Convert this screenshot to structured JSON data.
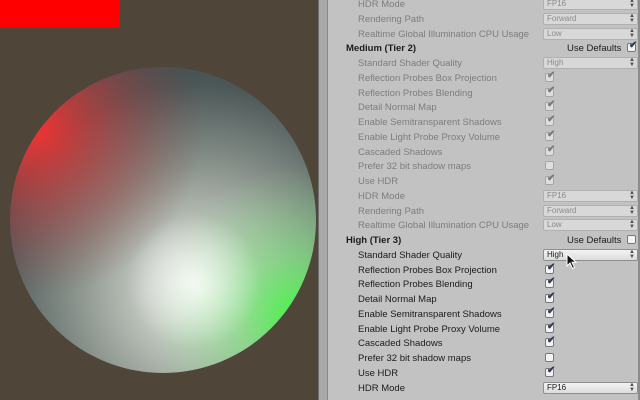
{
  "colors": {
    "viewport_bg": "#4f4639",
    "red_rect": "#ff0000",
    "panel_bg": "#c2c2c2"
  },
  "rows": [
    {
      "label": "HDR Mode",
      "control": "dropdown",
      "value": "FP16",
      "enabled": false
    },
    {
      "label": "Rendering Path",
      "control": "dropdown",
      "value": "Forward",
      "enabled": false
    },
    {
      "label": "Realtime Global Illumination CPU Usage",
      "control": "dropdown",
      "value": "Low",
      "enabled": false
    },
    {
      "label": "Medium (Tier 2)",
      "control": "header",
      "use_defaults_label": "Use Defaults",
      "checked": true
    },
    {
      "label": "Standard Shader Quality",
      "control": "dropdown",
      "value": "High",
      "enabled": false
    },
    {
      "label": "Reflection Probes Box Projection",
      "control": "checkbox",
      "checked": true,
      "enabled": false
    },
    {
      "label": "Reflection Probes Blending",
      "control": "checkbox",
      "checked": true,
      "enabled": false
    },
    {
      "label": "Detail Normal Map",
      "control": "checkbox",
      "checked": true,
      "enabled": false
    },
    {
      "label": "Enable Semitransparent Shadows",
      "control": "checkbox",
      "checked": true,
      "enabled": false
    },
    {
      "label": "Enable Light Probe Proxy Volume",
      "control": "checkbox",
      "checked": true,
      "enabled": false
    },
    {
      "label": "Cascaded Shadows",
      "control": "checkbox",
      "checked": true,
      "enabled": false
    },
    {
      "label": "Prefer 32 bit shadow maps",
      "control": "checkbox",
      "checked": false,
      "enabled": false
    },
    {
      "label": "Use HDR",
      "control": "checkbox",
      "checked": true,
      "enabled": false
    },
    {
      "label": "HDR Mode",
      "control": "dropdown",
      "value": "FP16",
      "enabled": false
    },
    {
      "label": "Rendering Path",
      "control": "dropdown",
      "value": "Forward",
      "enabled": false
    },
    {
      "label": "Realtime Global Illumination CPU Usage",
      "control": "dropdown",
      "value": "Low",
      "enabled": false
    },
    {
      "label": "High (Tier 3)",
      "control": "header",
      "use_defaults_label": "Use Defaults",
      "checked": false
    },
    {
      "label": "Standard Shader Quality",
      "control": "dropdown",
      "value": "High",
      "enabled": true
    },
    {
      "label": "Reflection Probes Box Projection",
      "control": "checkbox",
      "checked": true,
      "enabled": true
    },
    {
      "label": "Reflection Probes Blending",
      "control": "checkbox",
      "checked": true,
      "enabled": true
    },
    {
      "label": "Detail Normal Map",
      "control": "checkbox",
      "checked": true,
      "enabled": true
    },
    {
      "label": "Enable Semitransparent Shadows",
      "control": "checkbox",
      "checked": true,
      "enabled": true
    },
    {
      "label": "Enable Light Probe Proxy Volume",
      "control": "checkbox",
      "checked": true,
      "enabled": true
    },
    {
      "label": "Cascaded Shadows",
      "control": "checkbox",
      "checked": true,
      "enabled": true
    },
    {
      "label": "Prefer 32 bit shadow maps",
      "control": "checkbox",
      "checked": false,
      "enabled": true
    },
    {
      "label": "Use HDR",
      "control": "checkbox",
      "checked": true,
      "enabled": true
    },
    {
      "label": "HDR Mode",
      "control": "dropdown",
      "value": "FP16",
      "enabled": true
    }
  ]
}
